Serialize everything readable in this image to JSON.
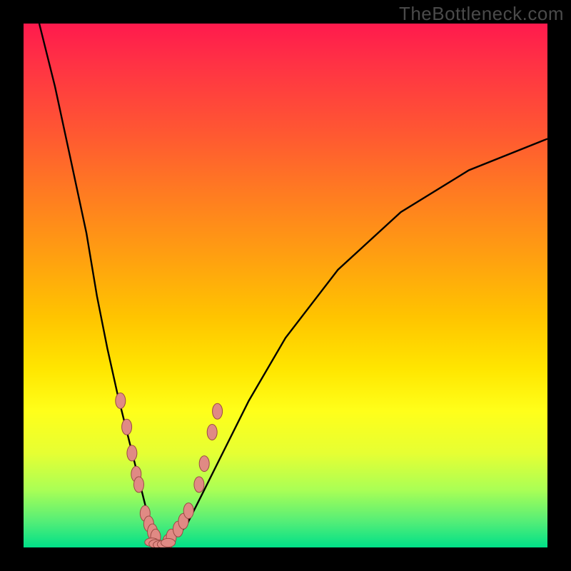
{
  "watermark": "TheBottleneck.com",
  "chart_data": {
    "type": "line",
    "title": "",
    "xlabel": "",
    "ylabel": "",
    "xlim": [
      0,
      100
    ],
    "ylim": [
      0,
      100
    ],
    "series": [
      {
        "name": "bottleneck-curve",
        "x": [
          3,
          6,
          9,
          12,
          14,
          16,
          18,
          20,
          22,
          23.5,
          25,
          26,
          27,
          28,
          31,
          34,
          38,
          43,
          50,
          60,
          72,
          85,
          100
        ],
        "y": [
          100,
          88,
          74,
          60,
          48,
          38,
          29,
          21,
          13,
          7,
          3,
          1,
          0.5,
          1,
          4,
          10,
          18,
          28,
          40,
          53,
          64,
          72,
          78
        ]
      }
    ],
    "markers_left": {
      "name": "dots-descending",
      "x": [
        18.5,
        19.7,
        20.7,
        21.5,
        22.0,
        23.2,
        23.9,
        24.6,
        25.2
      ],
      "y": [
        28,
        23,
        18,
        14,
        12,
        6.5,
        4.5,
        3,
        2
      ]
    },
    "markers_right": {
      "name": "dots-ascending",
      "x": [
        27.5,
        28.2,
        29.5,
        30.5,
        31.5,
        33.5,
        34.5,
        36.0,
        37.0
      ],
      "y": [
        1,
        2,
        3.5,
        5,
        7,
        12,
        16,
        22,
        26
      ]
    },
    "markers_bottom": {
      "name": "dots-valley",
      "x": [
        24.5,
        25.3,
        26.1,
        26.9,
        27.6
      ],
      "y": [
        1,
        0.7,
        0.5,
        0.6,
        0.9
      ]
    },
    "colors": {
      "curve": "#000000",
      "marker_fill": "#e08a84",
      "marker_stroke": "#9a4a44"
    }
  }
}
